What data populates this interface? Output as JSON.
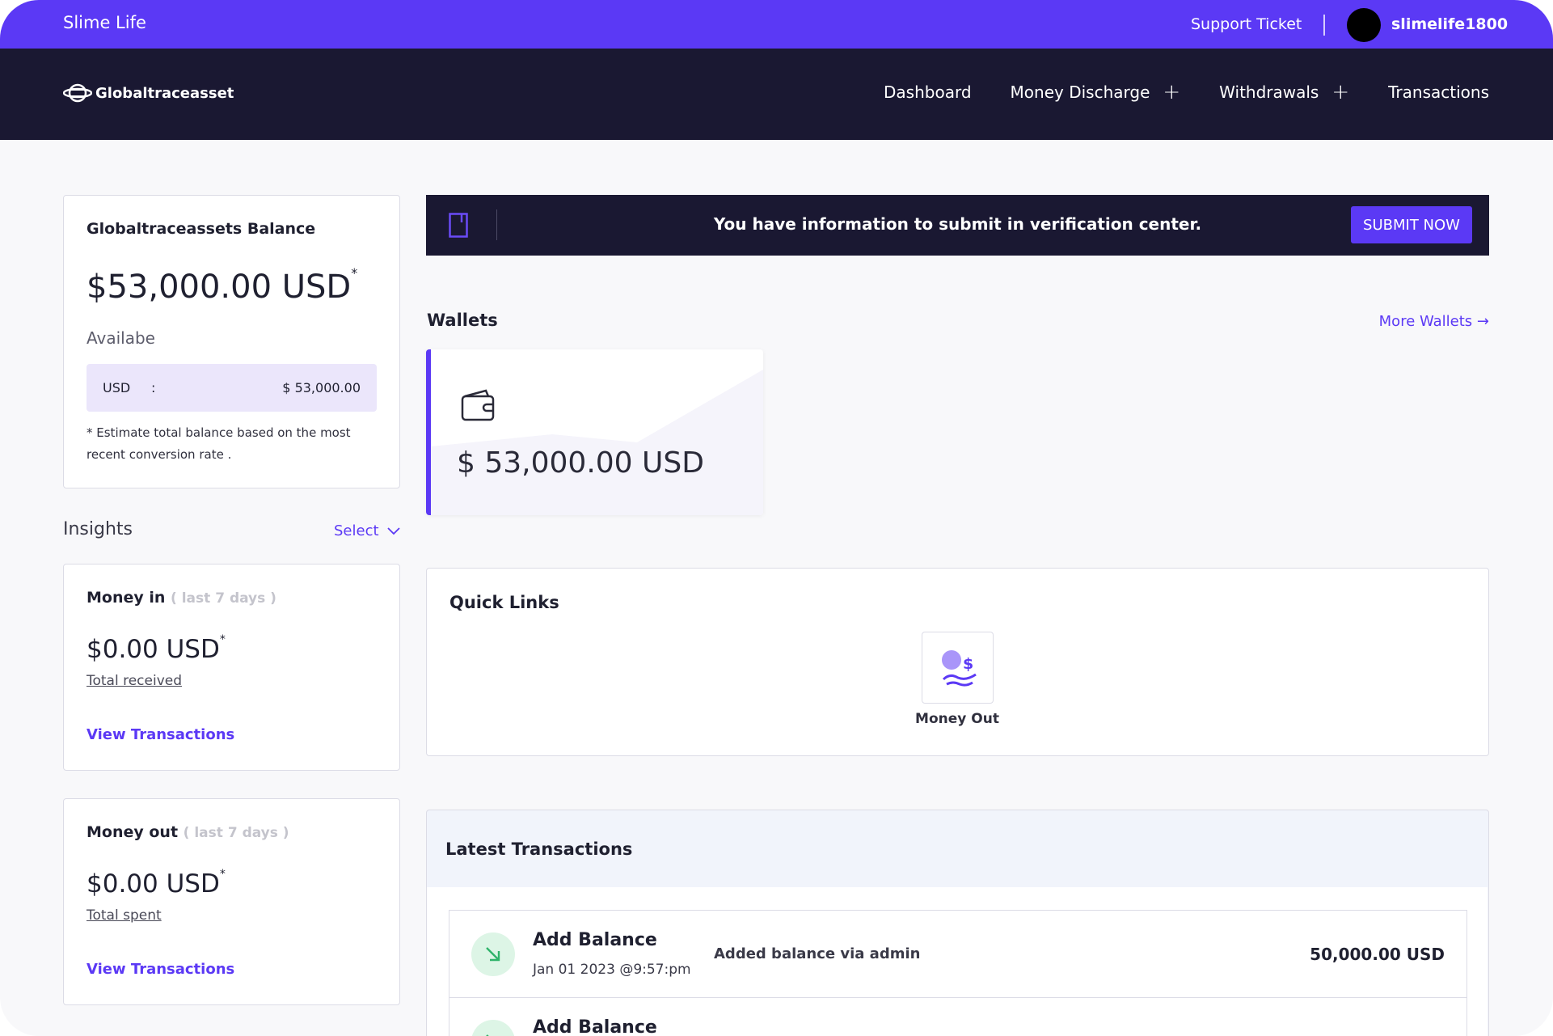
{
  "topbar": {
    "brand": "Slime Life",
    "support": "Support Ticket",
    "username": "slimelife1800"
  },
  "nav": {
    "logo_text": "Globaltraceasset",
    "links": [
      {
        "label": "Dashboard"
      },
      {
        "label": "Money Discharge",
        "expandable": true
      },
      {
        "label": "Withdrawals",
        "expandable": true
      },
      {
        "label": "Transactions"
      }
    ]
  },
  "balance": {
    "title": "Globaltraceassets Balance",
    "amount": "$53,000.00 USD",
    "asterisk": "*",
    "available_label": "Availabe",
    "currency_code": "USD",
    "colon": ":",
    "currency_value": "$ 53,000.00",
    "note": "* Estimate total balance based on the most recent conversion rate ."
  },
  "insights": {
    "label": "Insights",
    "select_label": "Select"
  },
  "money_in": {
    "title": "Money in",
    "period": "( last 7 days )",
    "amount": "$0.00 USD",
    "asterisk": "*",
    "total_label": "Total received",
    "link": "View Transactions"
  },
  "money_out": {
    "title": "Money out",
    "period": "( last 7 days )",
    "amount": "$0.00 USD",
    "asterisk": "*",
    "total_label": "Total spent",
    "link": "View Transactions"
  },
  "verification": {
    "message": "You have information to submit in verification center.",
    "button": "SUBMIT NOW"
  },
  "wallets": {
    "heading": "Wallets",
    "more_link": "More Wallets →",
    "items": [
      {
        "amount": "$ 53,000.00 USD",
        "icon": "wallet-icon"
      }
    ]
  },
  "quick_links": {
    "heading": "Quick Links",
    "items": [
      {
        "label": "Money Out",
        "icon": "money-out-icon"
      }
    ]
  },
  "latest": {
    "heading": "Latest Transactions",
    "rows": [
      {
        "title": "Add Balance",
        "date": "Jan 01 2023 @9:57:pm",
        "description": "Added balance via admin",
        "amount": "50,000.00 USD",
        "icon": "arrow-down-right-icon"
      },
      {
        "title": "Add Balance",
        "date": "",
        "description": "",
        "amount": "",
        "icon": "arrow-down-right-icon"
      }
    ]
  },
  "colors": {
    "accent": "#5b39f5",
    "navy": "#1a1832",
    "success_bg": "#ddf5e6",
    "success": "#2fb36a"
  }
}
